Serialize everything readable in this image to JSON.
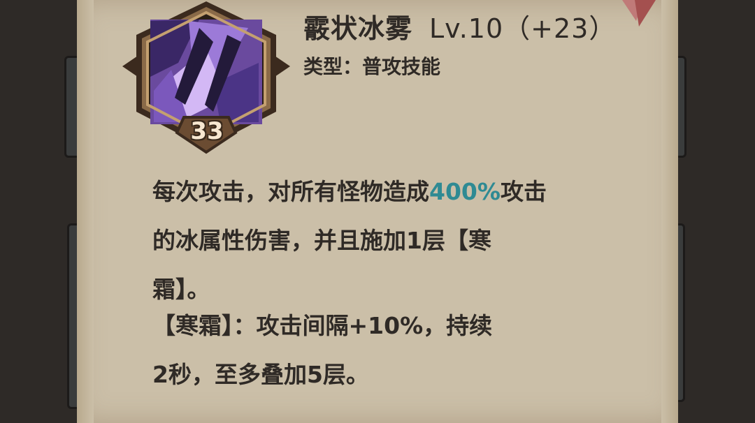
{
  "skill": {
    "name": "霰状冰雾",
    "level": "Lv.10（+23）",
    "type_label": "类型：普攻技能",
    "icon_level": "33",
    "icon_name": "ice-shard-skill-icon"
  },
  "description": {
    "line1_a": "每次攻击，对所有怪物造成",
    "line1_highlight": "400%",
    "line1_b": "攻击",
    "line2": "的冰属性伤害，并且施加1层【寒",
    "line3": "霜】。",
    "line4": "【寒霜】：攻击间隔+10%，持续",
    "line5": "2秒，至多叠加5层。"
  },
  "colors": {
    "highlight": "#2f8a93",
    "parchment": "#cbbfa8",
    "text": "#2f2a26"
  }
}
